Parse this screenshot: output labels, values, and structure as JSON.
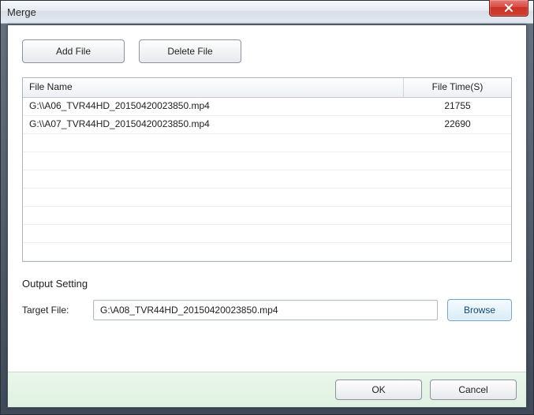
{
  "window": {
    "title": "Merge"
  },
  "toolbar": {
    "add_file": "Add File",
    "delete_file": "Delete File"
  },
  "filelist": {
    "columns": {
      "name": "File Name",
      "time": "File Time(S)"
    },
    "rows": [
      {
        "name": "G:\\\\A06_TVR44HD_20150420023850.mp4",
        "time": "21755"
      },
      {
        "name": "G:\\\\A07_TVR44HD_20150420023850.mp4",
        "time": "22690"
      }
    ]
  },
  "output": {
    "section_title": "Output Setting",
    "target_label": "Target File:",
    "target_value": "G:\\A08_TVR44HD_20150420023850.mp4",
    "browse": "Browse"
  },
  "footer": {
    "ok": "OK",
    "cancel": "Cancel"
  }
}
